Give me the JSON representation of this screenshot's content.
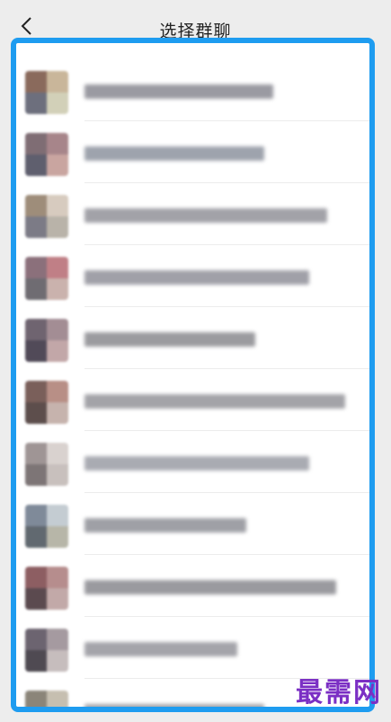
{
  "navbar": {
    "title": "选择群聊",
    "back_icon": "chevron-left-icon"
  },
  "groups": [
    {
      "name": "",
      "avatar_colors": [
        "#8a6a5c",
        "#c9b69a",
        "#6d6f7d",
        "#d2d0b8"
      ],
      "bar_color": "#9a9aa2"
    },
    {
      "name": "",
      "avatar_colors": [
        "#7f6d74",
        "#a7858a",
        "#5f5f6e",
        "#c9a5a0"
      ],
      "bar_color": "#9ea3ad"
    },
    {
      "name": "",
      "avatar_colors": [
        "#9e8d7a",
        "#d7cbbf",
        "#7c7b86",
        "#b9b3a9"
      ],
      "bar_color": "#a2a2a8"
    },
    {
      "name": "",
      "avatar_colors": [
        "#8b707b",
        "#c07f86",
        "#6f6c72",
        "#cab2ad"
      ],
      "bar_color": "#a0a0a8"
    },
    {
      "name": "",
      "avatar_colors": [
        "#6f6470",
        "#a38d94",
        "#514a58",
        "#c2a7a8"
      ],
      "bar_color": "#9b9b9f"
    },
    {
      "name": "",
      "avatar_colors": [
        "#7a5f5a",
        "#b88f86",
        "#5d4e4c",
        "#c6b3ad"
      ],
      "bar_color": "#a3a3a8"
    },
    {
      "name": "",
      "avatar_colors": [
        "#9f9595",
        "#d9d2cf",
        "#7d7576",
        "#c8c0bd"
      ],
      "bar_color": "#a9abb2"
    },
    {
      "name": "",
      "avatar_colors": [
        "#7f8a99",
        "#c4ccd2",
        "#616970",
        "#b7b6a8"
      ],
      "bar_color": "#9fa0a6"
    },
    {
      "name": "",
      "avatar_colors": [
        "#8d5e62",
        "#b68d8d",
        "#5b4a4f",
        "#c2a9a8"
      ],
      "bar_color": "#9a9a9f"
    },
    {
      "name": "",
      "avatar_colors": [
        "#6c6470",
        "#a59aa0",
        "#4f4a52",
        "#c6bdbd"
      ],
      "bar_color": "#a4a4aa"
    },
    {
      "name": "",
      "avatar_colors": [
        "#8b8579",
        "#c6bfb0",
        "#6d6a64",
        "#bdb7ab"
      ],
      "bar_color": "#a6a6ab"
    }
  ],
  "watermark": "最需网",
  "colors": {
    "highlight_border": "#1e9cf0",
    "watermark": "#7b2fc4"
  }
}
